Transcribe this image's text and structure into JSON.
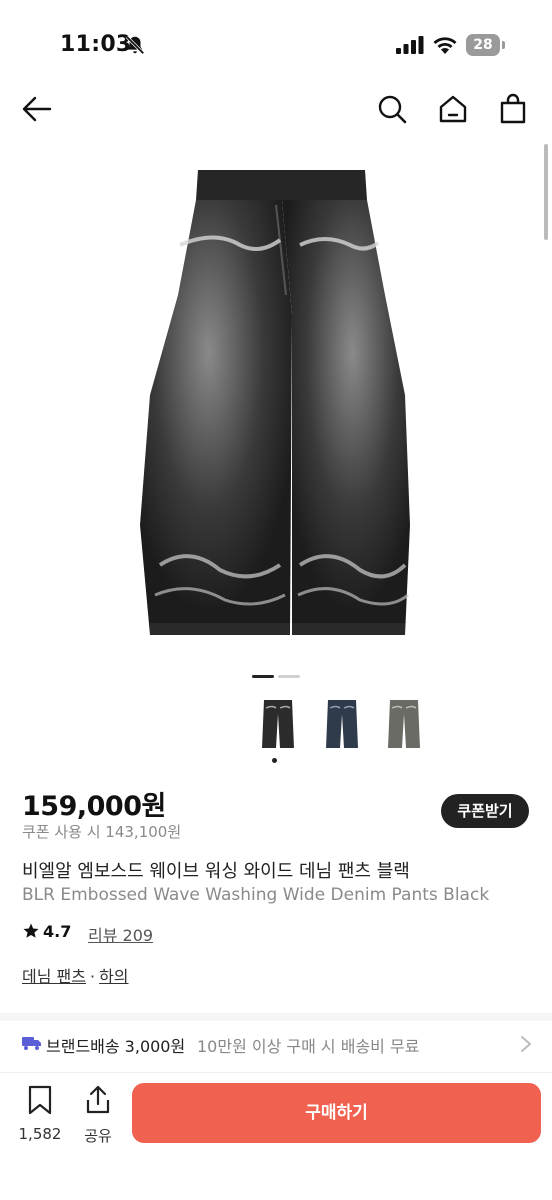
{
  "status_bar": {
    "time": "11:03",
    "battery": "28"
  },
  "product": {
    "price": "159,000원",
    "coupon_price": "쿠폰 사용 시 143,100원",
    "coupon_button": "쿠폰받기",
    "title_ko": "비엘알 엠보스드 웨이브 워싱 와이드 데님 팬츠 블랙",
    "title_en": "BLR Embossed Wave Washing Wide Denim Pants Black",
    "rating": "4.7",
    "review_label": "리뷰 209",
    "category": "데님 팬츠",
    "category_separator": "·",
    "subcategory": "하의"
  },
  "shipping": {
    "label": "브랜드배송 3,000원",
    "condition": "10만원 이상 구매 시 배송비 무료"
  },
  "bottom_bar": {
    "like_count": "1,582",
    "share_label": "공유",
    "buy_label": "구매하기"
  },
  "gallery": {
    "current_index": 1,
    "total": 2
  },
  "icons": [
    "back-arrow-icon",
    "search-icon",
    "home-icon",
    "shopping-bag-icon",
    "star-icon",
    "truck-icon",
    "chevron-right-icon",
    "bookmark-icon",
    "share-icon",
    "bell-slash-icon",
    "signal-icon",
    "wifi-icon",
    "battery-icon"
  ],
  "colors": {
    "accent": "#f0614f",
    "dark_button": "#222222",
    "muted_text": "#8a8a8a",
    "truck": "#5b5fd6"
  }
}
